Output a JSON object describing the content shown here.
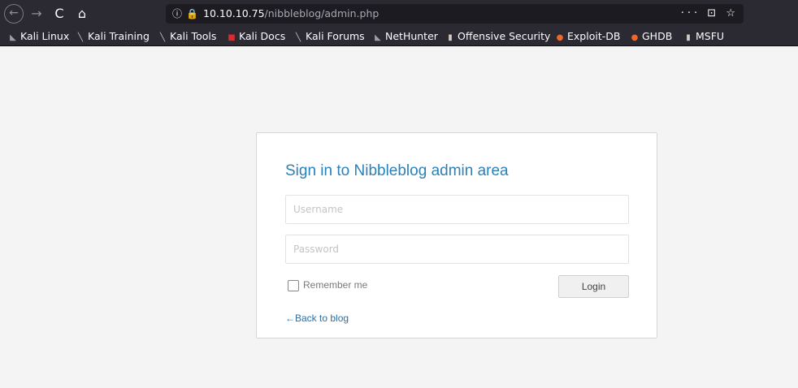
{
  "browser": {
    "nav": {
      "back_icon": "←",
      "forward_icon": "→",
      "reload_icon": "C",
      "home_icon": "⌂"
    },
    "url": {
      "info_icon": "ⓘ",
      "insecure_icon": "🔒",
      "host": "10.10.10.75",
      "path": "/nibbleblog/admin.php",
      "actions": "··· ⊡ ☆"
    },
    "bookmarks": [
      {
        "label": "Kali Linux",
        "icon": "kali-dragon-icon",
        "glyph": "◣",
        "color": "#9aa0a6"
      },
      {
        "label": "Kali Training",
        "icon": "kali-dragon-icon",
        "glyph": "╲",
        "color": "#c9c9c9"
      },
      {
        "label": "Kali Tools",
        "icon": "kali-dragon-icon",
        "glyph": "╲",
        "color": "#c9c9c9"
      },
      {
        "label": "Kali Docs",
        "icon": "kali-docs-icon",
        "glyph": "■",
        "color": "#e0292b"
      },
      {
        "label": "Kali Forums",
        "icon": "kali-dragon-icon",
        "glyph": "╲",
        "color": "#c9c9c9"
      },
      {
        "label": "NetHunter",
        "icon": "nethunter-icon",
        "glyph": "◣",
        "color": "#9aa0a6"
      },
      {
        "label": "Offensive Security",
        "icon": "offsec-icon",
        "glyph": "▮",
        "color": "#d7c9c0"
      },
      {
        "label": "Exploit-DB",
        "icon": "exploit-db-icon",
        "glyph": "●",
        "color": "#f26522"
      },
      {
        "label": "GHDB",
        "icon": "ghdb-icon",
        "glyph": "●",
        "color": "#f26522"
      },
      {
        "label": "MSFU",
        "icon": "msfu-icon",
        "glyph": "▮",
        "color": "#d7c9c0"
      }
    ]
  },
  "login": {
    "title": "Sign in to Nibbleblog admin area",
    "username_placeholder": "Username",
    "password_placeholder": "Password",
    "remember_label": "Remember me",
    "login_label": "Login",
    "back_link": "←Back to blog",
    "accent_color": "#2a80b9"
  }
}
